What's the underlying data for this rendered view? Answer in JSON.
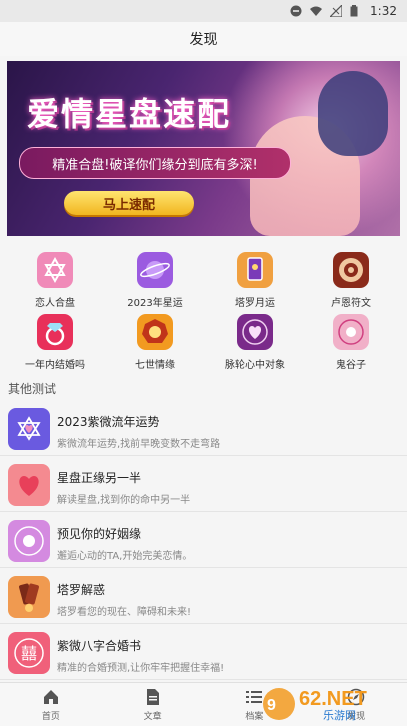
{
  "statusbar": {
    "time": "1:32"
  },
  "title": "发现",
  "banner": {
    "title": "爱情星盘速配",
    "subtitle": "精准合盘!破译你们缘分到底有多深!",
    "button": "马上速配"
  },
  "grid": [
    {
      "label": "恋人合盘",
      "icon": "star-of-david-icon",
      "color": "#f08ab8"
    },
    {
      "label": "2023年星运",
      "icon": "planet-icon",
      "color": "#9b5be0"
    },
    {
      "label": "塔罗月运",
      "icon": "tarot-card-icon",
      "color": "#f0a040"
    },
    {
      "label": "卢恩符文",
      "icon": "rune-emblem-icon",
      "color": "#8a2a1a"
    },
    {
      "label": "一年内结婚吗",
      "icon": "diamond-ring-icon",
      "color": "#e8305a"
    },
    {
      "label": "七世情缘",
      "icon": "bagua-icon",
      "color": "#f29a20"
    },
    {
      "label": "脉轮心中对象",
      "icon": "chakra-heart-icon",
      "color": "#7a2a8a"
    },
    {
      "label": "鬼谷子",
      "icon": "yin-yang-pattern-icon",
      "color": "#f1b0c8"
    }
  ],
  "section_title": "其他测试",
  "tests": [
    {
      "title": "2023紫微流年运势",
      "desc": "紫微流年运势,找前早晚变数不走弯路",
      "icon": "star-heart-icon",
      "color": "#6a5ae0"
    },
    {
      "title": "星盘正缘另一半",
      "desc": "解读星盘,找到你的命中另一半",
      "icon": "heart-icon",
      "color": "#f48a90"
    },
    {
      "title": "预见你的好姻缘",
      "desc": "邂逅心动的TA,开始完美恋情。",
      "icon": "bagua-pattern-icon",
      "color": "#d48ae0"
    },
    {
      "title": "塔罗解惑",
      "desc": "塔罗看您的现在、障碍和未来!",
      "icon": "tarot-fan-icon",
      "color": "#f09a50"
    },
    {
      "title": "紫微八字合婚书",
      "desc": "精准的合婚预测,让你牢牢把握住幸福!",
      "icon": "double-happiness-icon",
      "color": "#f0607a"
    }
  ],
  "tabs": [
    {
      "label": "首页",
      "icon": "home-icon"
    },
    {
      "label": "文章",
      "icon": "document-icon"
    },
    {
      "label": "档案",
      "icon": "list-icon"
    },
    {
      "label": "发现",
      "icon": "discover-icon"
    }
  ],
  "watermark": "962.NET 乐游网"
}
